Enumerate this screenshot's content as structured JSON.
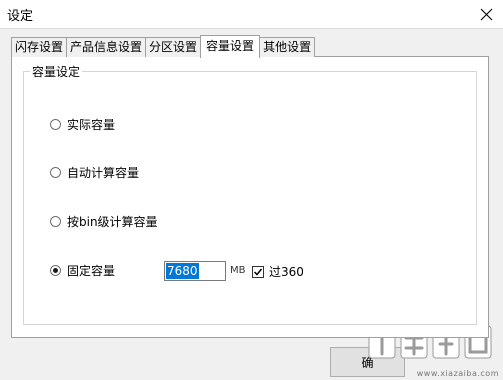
{
  "window": {
    "title": "设定"
  },
  "tabs": [
    {
      "label": "闪存设置",
      "active": false
    },
    {
      "label": "产品信息设置",
      "active": false
    },
    {
      "label": "分区设置",
      "active": false
    },
    {
      "label": "容量设置",
      "active": true
    },
    {
      "label": "其他设置",
      "active": false
    }
  ],
  "group": {
    "title": "容量设定",
    "options": [
      {
        "label": "实际容量",
        "checked": false
      },
      {
        "label": "自动计算容量",
        "checked": false
      },
      {
        "label": "按bin级计算容量",
        "checked": false
      },
      {
        "label": "固定容量",
        "checked": true
      }
    ],
    "capacity_value": "7680",
    "unit": "MB",
    "checkbox_label": "过360",
    "checkbox_checked": true
  },
  "buttons": {
    "confirm_label": "确"
  },
  "watermark": {
    "url": "www.xiazaiba.com"
  }
}
